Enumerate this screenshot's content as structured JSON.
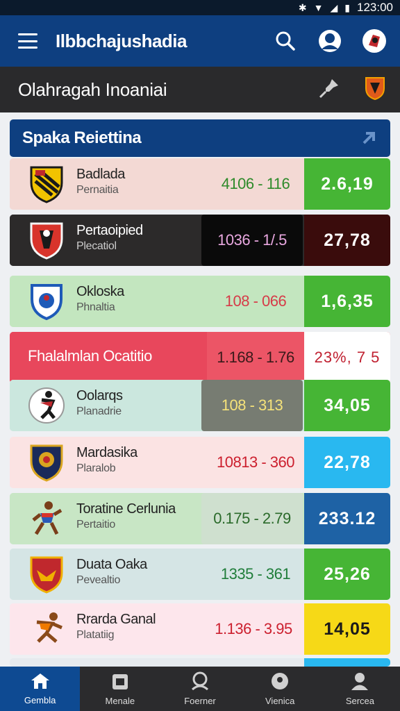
{
  "status_bar": {
    "time": "123:00",
    "icons": [
      "bluetooth-icon",
      "wifi-icon",
      "signal-icon",
      "battery-icon"
    ]
  },
  "app_bar": {
    "title": "Ilbbchajushadia",
    "icons": [
      "hamburger-icon",
      "search-icon",
      "account-icon",
      "team-crest-icon"
    ]
  },
  "section": {
    "title": "Olahragah Inoaniai",
    "icons": [
      "pin-icon",
      "team-shield-icon"
    ]
  },
  "list_header": {
    "title": "Spaka Reiettina",
    "icon": "arrow-up-right-icon"
  },
  "matches": [
    {
      "name": "Badlada",
      "sub": "Pernaitia",
      "odds": "4106 - 116",
      "value": "2.6,19",
      "colors": {
        "row": "#f3d9d4",
        "odds_bg": "#f3d9d4",
        "odds_text": "#2e8a2a",
        "badge_bg": "#46b535",
        "badge_text": "#ffffff"
      },
      "logo": "striped-shield-icon"
    },
    {
      "name": "Pertaoipied",
      "sub": "Plecatiol",
      "odds": "1036 - 1/.5",
      "value": "27,78",
      "colors": {
        "row": "#2c2a2a",
        "odds_bg": "#0a0a0a",
        "odds_text": "#e9a8e0",
        "badge_bg": "#3a0c0c",
        "badge_text": "#ffffff"
      },
      "logo": "red-shield-icon"
    },
    {
      "name": "Okloska",
      "sub": "Phnaltia",
      "odds": "108 - 066",
      "value": "1,6,35",
      "colors": {
        "row": "#c3e6bf",
        "odds_bg": "#c3e6bf",
        "odds_text": "#d63b48",
        "badge_bg": "#46b535",
        "badge_text": "#ffffff"
      },
      "logo": "blue-crest-icon"
    },
    {
      "name": "Fhalalmlan Ocatitio",
      "sub": "",
      "odds": "1.168 - 1.76",
      "value": "23%, 7 5",
      "colors": {
        "row": "#e8475c",
        "odds_bg": "#ec5566",
        "odds_text": "#3a1a1a",
        "badge_bg": "#ffffff",
        "badge_text": "#c02030"
      },
      "logo": ""
    },
    {
      "name": "Oolarqs",
      "sub": "Planadrie",
      "odds": "108 - 313",
      "value": "34,05",
      "colors": {
        "row": "#cbe7de",
        "odds_bg": "#777c72",
        "odds_text": "#f5e27a",
        "badge_bg": "#46b535",
        "badge_text": "#ffffff"
      },
      "logo": "player-icon"
    },
    {
      "name": "Mardasika",
      "sub": "Plaralob",
      "odds": "10813 - 360",
      "value": "22,78",
      "colors": {
        "row": "#fbe3e3",
        "odds_bg": "#fbe3e3",
        "odds_text": "#cc1f2e",
        "badge_bg": "#29b8f0",
        "badge_text": "#ffffff"
      },
      "logo": "lion-crest-icon"
    },
    {
      "name": "Toratine Cerlunia",
      "sub": "Pertaitio",
      "odds": "0.175 - 2.79",
      "value": "233.12",
      "colors": {
        "row": "#c8e6c5",
        "odds_bg": "#cfe0cf",
        "odds_text": "#2a6a2a",
        "badge_bg": "#1e62a5",
        "badge_text": "#ffffff"
      },
      "logo": "runner-icon"
    },
    {
      "name": "Duata Oaka",
      "sub": "Pevealtio",
      "odds": "1335 - 361",
      "value": "25,26",
      "colors": {
        "row": "#d5e5e5",
        "odds_bg": "#d5e5e5",
        "odds_text": "#1f7d3a",
        "badge_bg": "#46b535",
        "badge_text": "#ffffff"
      },
      "logo": "eagle-shield-icon"
    },
    {
      "name": "Rrarda Ganal",
      "sub": "Platatiig",
      "odds": "1.136 - 3.95",
      "value": "14,05",
      "colors": {
        "row": "#fde6ec",
        "odds_bg": "#fde6ec",
        "odds_text": "#cc1f2e",
        "badge_bg": "#f6d917",
        "badge_text": "#1a1a1a"
      },
      "logo": "sprinter-icon"
    }
  ],
  "bottom_nav": [
    {
      "label": "Gembla",
      "icon": "home-icon",
      "active": true
    },
    {
      "label": "Menale",
      "icon": "bag-icon",
      "active": false
    },
    {
      "label": "Foerner",
      "icon": "profile-icon",
      "active": false
    },
    {
      "label": "Vienica",
      "icon": "ball-icon",
      "active": false
    },
    {
      "label": "Sercea",
      "icon": "user-icon",
      "active": false
    }
  ]
}
